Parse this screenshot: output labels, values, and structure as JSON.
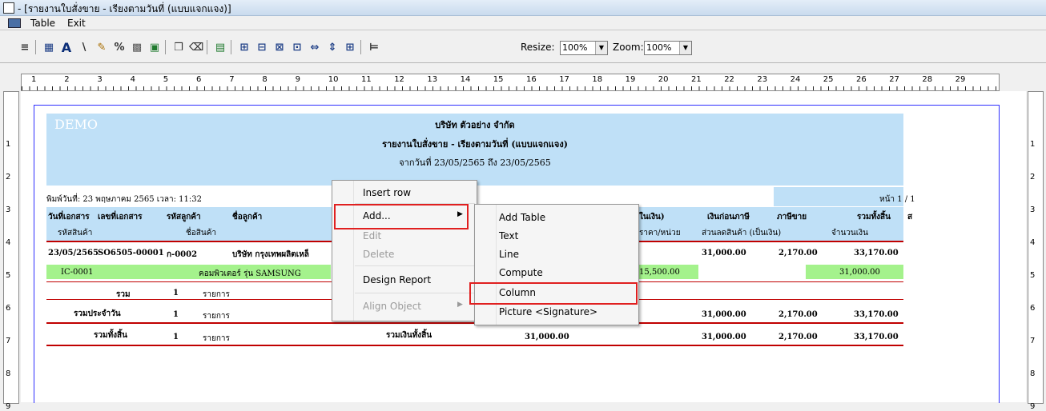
{
  "window": {
    "title": "- [รายงานใบสั่งขาย - เรียงตามวันที่ (แบบแจกแจง)]"
  },
  "menu": {
    "items": [
      "Table",
      "Exit"
    ]
  },
  "toolbar": {
    "resize_label": "Resize:",
    "resize_value": "100%",
    "zoom_label": "Zoom:",
    "zoom_value": "100%",
    "icons": [
      "align-icon",
      "table-icon",
      "text-icon",
      "line-icon",
      "pen-icon",
      "percent-icon",
      "grid-icon",
      "image-icon",
      "copy-icon",
      "eraser-icon",
      "chart-icon",
      "align-left-icon",
      "align-right-icon",
      "distribute-icon",
      "spacing-icon",
      "width-icon",
      "height-icon",
      "size-icon",
      "insert-icon"
    ]
  },
  "ruler": {
    "h_numbers": [
      "1",
      "2",
      "3",
      "4",
      "5",
      "6",
      "7",
      "8",
      "9",
      "10",
      "11",
      "12",
      "13",
      "14",
      "15",
      "16",
      "17",
      "18",
      "19",
      "20",
      "21",
      "22",
      "23",
      "24",
      "25",
      "26",
      "27",
      "28",
      "29"
    ],
    "v_numbers": [
      "1",
      "2",
      "3",
      "4",
      "5",
      "6",
      "7",
      "8",
      "9"
    ]
  },
  "report": {
    "demo": "DEMO",
    "company": "บริษัท ตัวอย่าง จำกัด",
    "title": "รายงานใบสั่งขาย - เรียงตามวันที่ (แบบแจกแจง)",
    "date_range": "จากวันที่ 23/05/2565 ถึง 23/05/2565",
    "printed": "พิมพ์วันที่: 23 พฤษภาคม 2565 เวลา: 11:32",
    "page": "หน้า 1 / 1",
    "col_headers": {
      "doc_date": "วันที่เอกสาร",
      "doc_no": "เลขที่เอกสาร",
      "cust_code": "รหัสลูกค้า",
      "cust_name": "ชื่อลูกค้า",
      "amount_partial": "ในเงิน)",
      "before_tax": "เงินก่อนภาษี",
      "tax": "ภาษีขาย",
      "total": "รวมทั้งสิ้น",
      "s": "ส"
    },
    "sub_headers": {
      "item_code": "รหัสสินค้า",
      "item_name": "ชื่อสินค้า",
      "unit_price": "ราคา/หน่วย",
      "discount": "ส่วนลดสินค้า (เป็นเงิน)",
      "amount": "จำนวนเงิน"
    },
    "row": {
      "date": "23/05/2565",
      "doc_no": "SO6505-00001",
      "cust_code": "ก-0002",
      "cust_name": "บริษัท กรุงเทพผลิตเหล็",
      "before_tax": "31,000.00",
      "tax": "2,170.00",
      "total": "33,170.00"
    },
    "item": {
      "code": "IC-0001",
      "name": "คอมพิวเตอร์ รุ่น SAMSUNG",
      "price": "15,500.00",
      "amount": "31,000.00"
    },
    "sum1": {
      "label": "รวม",
      "count": "1",
      "unit": "รายการ"
    },
    "sum2": {
      "label": "รวมประจำวัน",
      "count": "1",
      "unit": "รายการ",
      "before_tax": "31,000.00",
      "tax": "2,170.00",
      "total": "33,170.00"
    },
    "sum3": {
      "label": "รวมทั้งสิ้น",
      "count": "1",
      "unit": "รายการ",
      "grand_label": "รวมเงินทั้งสิ้น",
      "grand_amount": "31,000.00",
      "before_tax": "31,000.00",
      "tax": "2,170.00",
      "total": "33,170.00"
    }
  },
  "context_menu": {
    "items": [
      "Insert row",
      "Add...",
      "Edit",
      "Delete",
      "Design Report",
      "Align Object"
    ],
    "submenu": [
      "Add Table",
      "Text",
      "Line",
      "Compute",
      "Column",
      "Picture <Signature>"
    ]
  },
  "colors": {
    "band": "#bfe0f7",
    "highlight": "#e02020",
    "redline": "#c00000",
    "green": "#a4f28c"
  }
}
